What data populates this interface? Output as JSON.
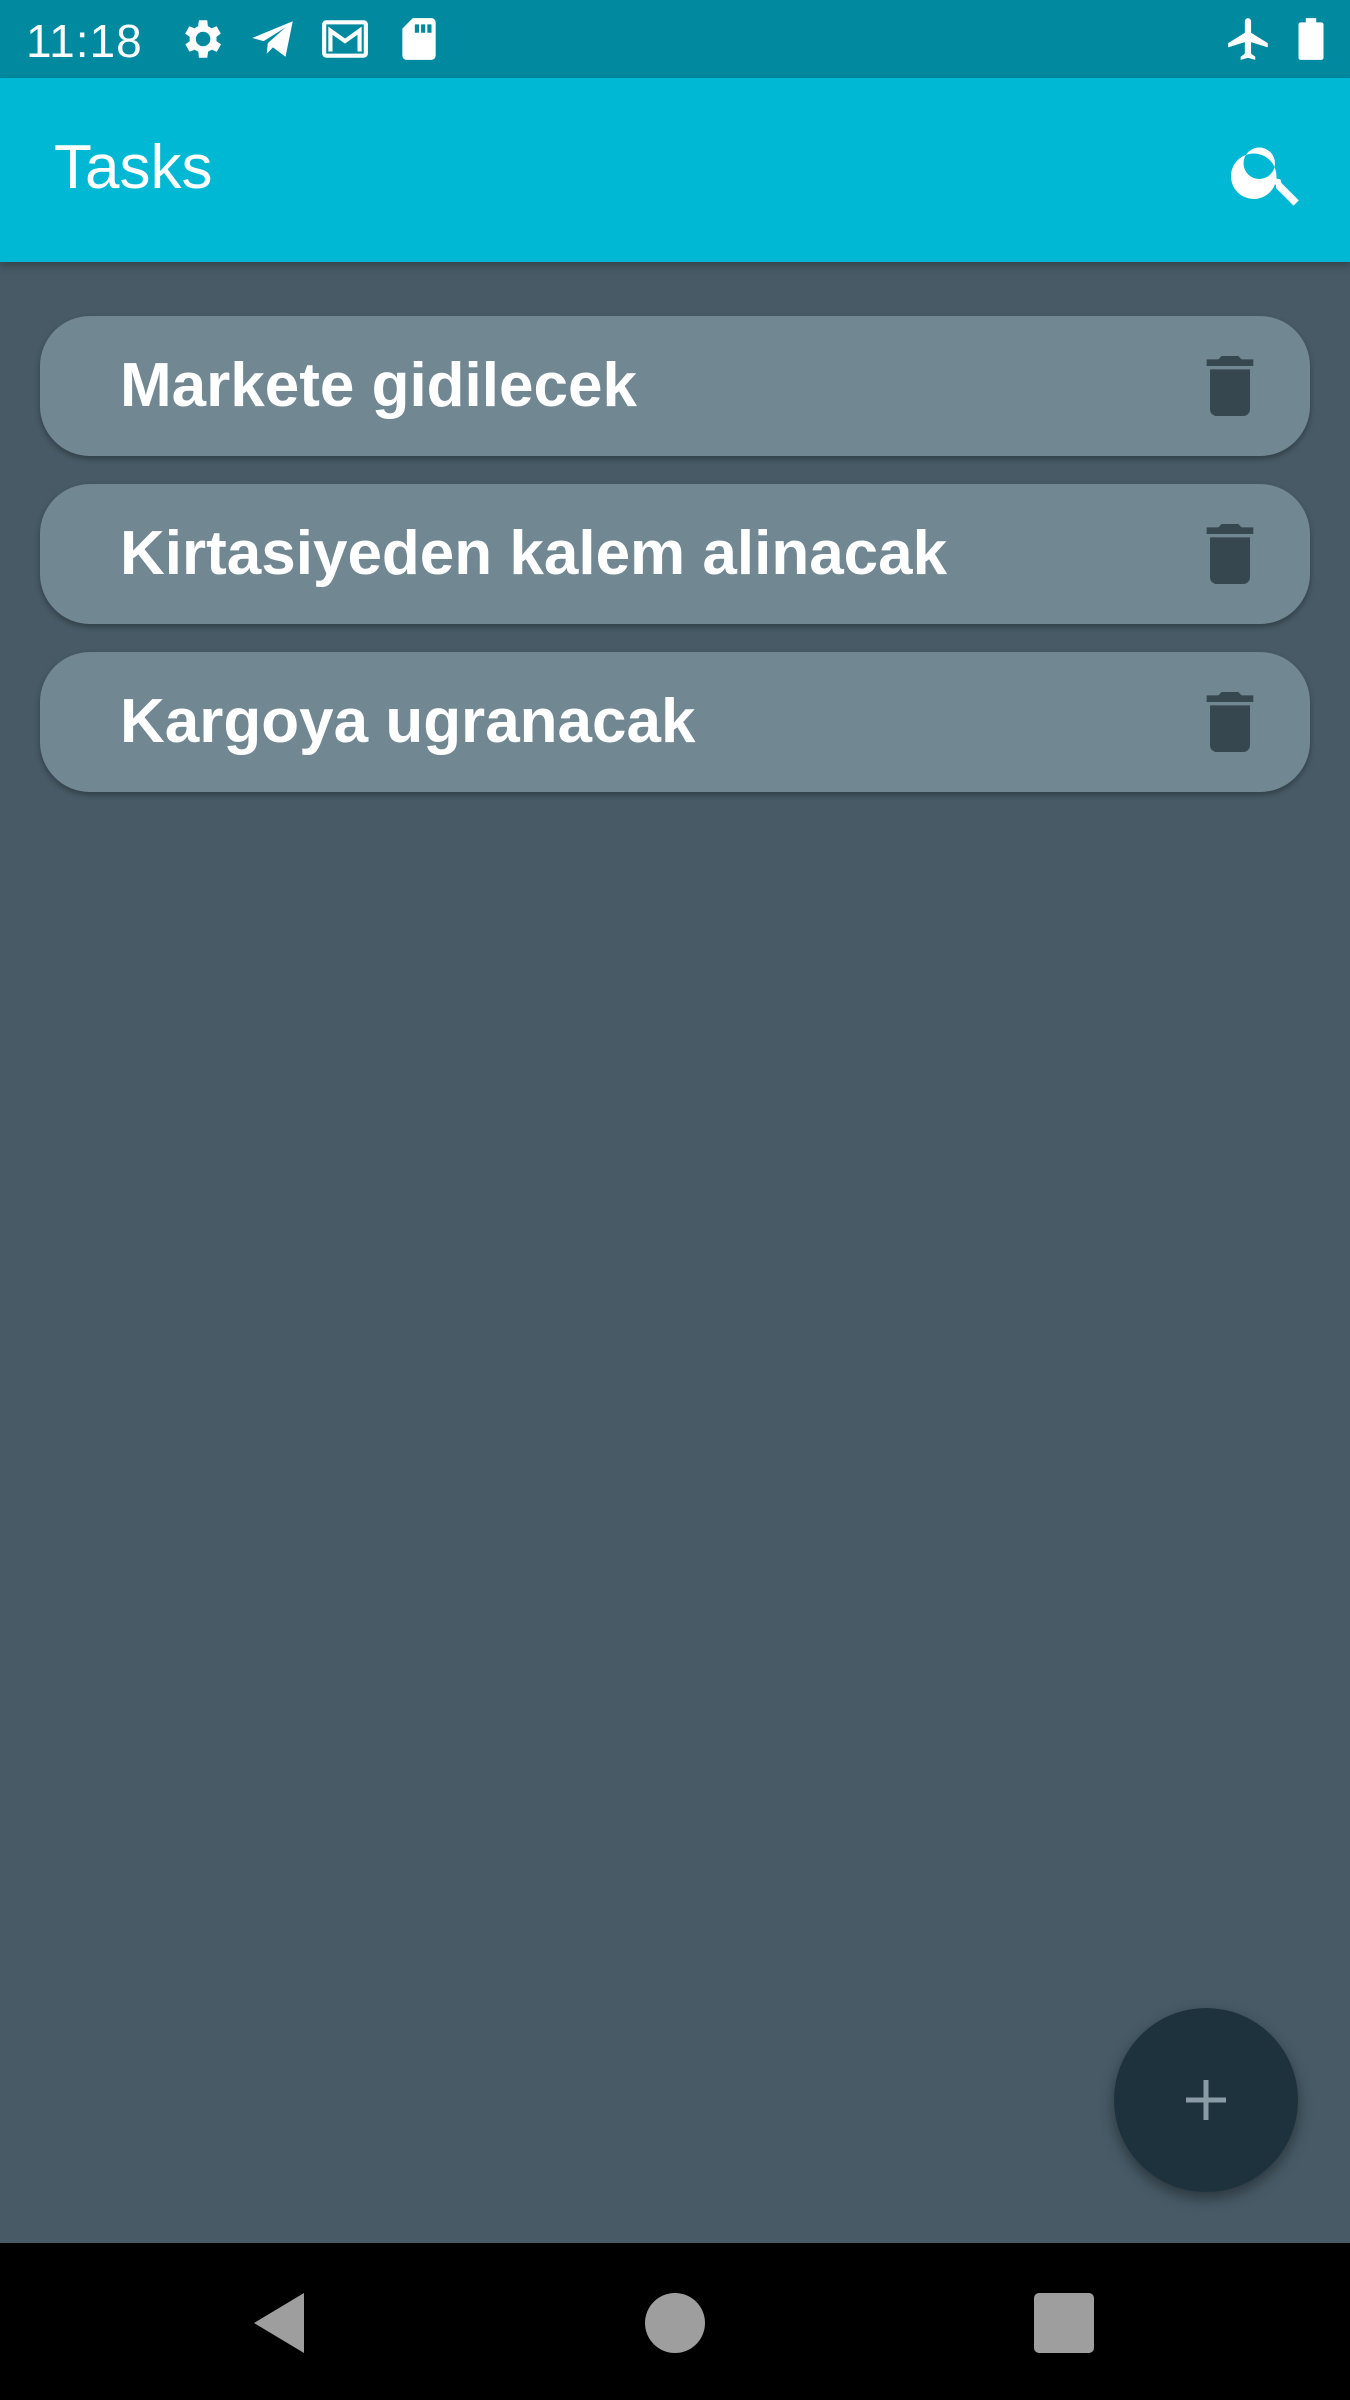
{
  "status_bar": {
    "time": "11:18",
    "icons": [
      "gear-icon",
      "telegram-icon",
      "gmail-icon",
      "sd-card-icon",
      "airplane-icon",
      "battery-icon"
    ]
  },
  "app_bar": {
    "title": "Tasks",
    "search_icon": "search-icon"
  },
  "tasks": [
    {
      "label": "Markete gidilecek"
    },
    {
      "label": "Kirtasiyeden kalem alinacak"
    },
    {
      "label": "Kargoya ugranacak"
    }
  ],
  "fab": {
    "icon": "plus-icon"
  },
  "nav_bar": {
    "icons": [
      "back-icon",
      "home-icon",
      "recents-icon"
    ]
  },
  "colors": {
    "status_bar": "#00899f",
    "app_bar": "#00b8d4",
    "background": "#475a66",
    "task_card": "#718792",
    "fab": "#1e323e",
    "trash": "#37474f"
  }
}
